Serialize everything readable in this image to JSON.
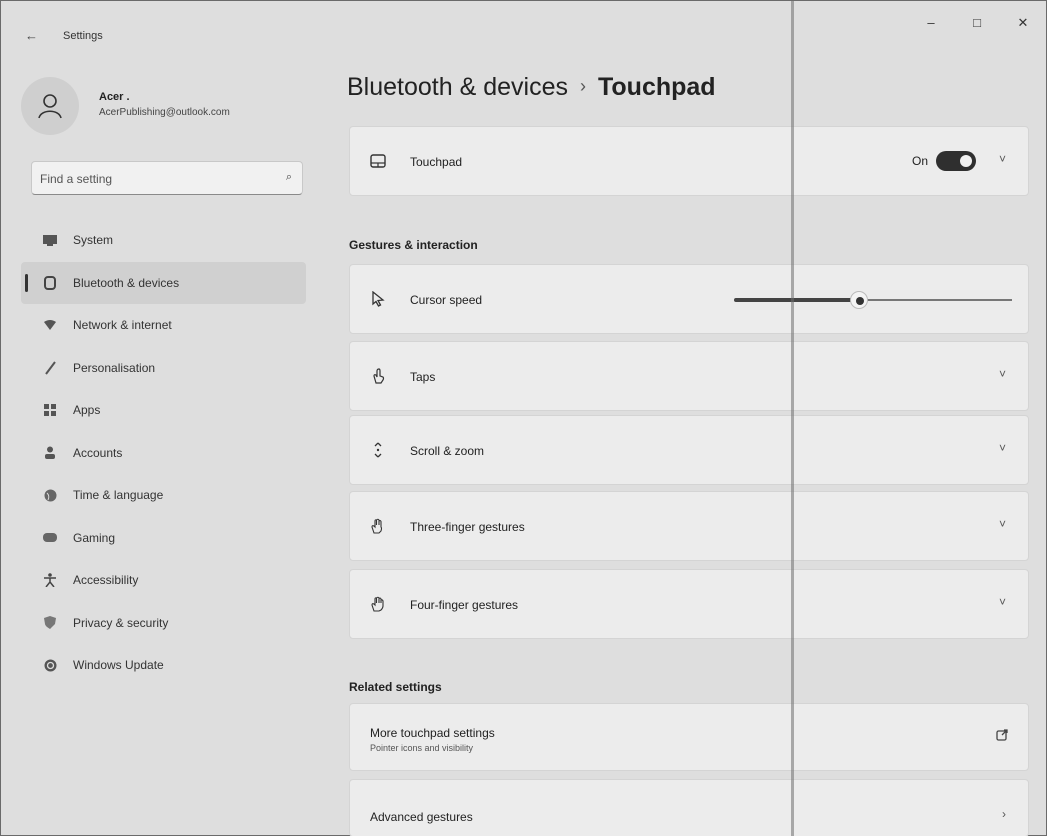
{
  "window": {
    "app_title": "Settings",
    "controls": {
      "minimize": "–",
      "maximize": "□",
      "close": "✕"
    }
  },
  "profile": {
    "name": "Acer .",
    "email": "AcerPublishing@outlook.com"
  },
  "search": {
    "placeholder": "Find a setting"
  },
  "sidebar": {
    "items": [
      {
        "label": "System",
        "icon": "system-icon"
      },
      {
        "label": "Bluetooth & devices",
        "icon": "bluetooth-icon",
        "selected": true
      },
      {
        "label": "Network & internet",
        "icon": "network-icon"
      },
      {
        "label": "Personalisation",
        "icon": "brush-icon"
      },
      {
        "label": "Apps",
        "icon": "apps-icon"
      },
      {
        "label": "Accounts",
        "icon": "accounts-icon"
      },
      {
        "label": "Time & language",
        "icon": "globe-icon"
      },
      {
        "label": "Gaming",
        "icon": "gamepad-icon"
      },
      {
        "label": "Accessibility",
        "icon": "accessibility-icon"
      },
      {
        "label": "Privacy & security",
        "icon": "shield-icon"
      },
      {
        "label": "Windows Update",
        "icon": "update-icon"
      }
    ]
  },
  "main": {
    "breadcrumb_parent": "Bluetooth & devices",
    "breadcrumb_sep": "›",
    "breadcrumb_current": "Touchpad",
    "touchpad": {
      "label": "Touchpad",
      "state": "On"
    },
    "gestures_section": "Gestures & interaction",
    "cursor_speed": {
      "label": "Cursor speed",
      "value_fraction": 0.45
    },
    "cards": [
      {
        "label": "Taps",
        "icon": "tap-icon"
      },
      {
        "label": "Scroll & zoom",
        "icon": "scroll-icon"
      },
      {
        "label": "Three-finger gestures",
        "icon": "three-finger-icon"
      },
      {
        "label": "Four-finger gestures",
        "icon": "four-finger-icon"
      }
    ],
    "related_section": "Related settings",
    "more_touchpad": {
      "title": "More touchpad settings",
      "subtitle": "Pointer icons and visibility"
    },
    "advanced_gestures": {
      "title": "Advanced gestures"
    }
  }
}
